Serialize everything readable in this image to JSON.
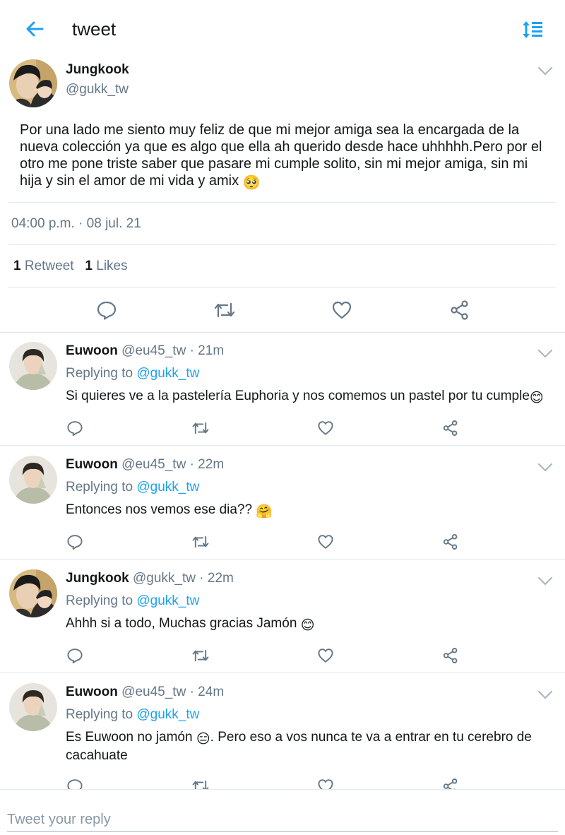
{
  "header": {
    "title": "tweet",
    "back_icon": "arrow-left-icon",
    "sort_icon": "sort-icon",
    "accent": "#1da1f2"
  },
  "tweet": {
    "name": "Jungkook",
    "handle": "@gukk_tw",
    "text": "Por una lado me siento muy feliz de que mi mejor amiga sea la encargada de la nueva colección ya que es algo que ella ah querido desde hace uhhhhh.Pero por el otro me pone triste saber que pasare mi cumple solito, sin mi mejor amiga, sin mi hija y sin el amor de mi vida y amix",
    "emoji": "🥺",
    "timestamp": "04:00 p.m. · 08 jul. 21",
    "retweets_count": "1",
    "retweets_label": "Retweet",
    "likes_count": "1",
    "likes_label": "Likes"
  },
  "replies": [
    {
      "name": "Euwoon",
      "meta": "@eu45_tw · 21m",
      "replying_label": "Replying to",
      "replying_handle": "@gukk_tw",
      "text": "Si quieres ve a la pastelería Euphoria y nos comemos un pastel por tu cumple",
      "emoji": "😊"
    },
    {
      "name": "Euwoon",
      "meta": "@eu45_tw · 22m",
      "replying_label": "Replying to",
      "replying_handle": "@gukk_tw",
      "text": "Entonces nos vemos ese dia?? ",
      "emoji": "🤗"
    },
    {
      "name": "Jungkook",
      "meta": "@gukk_tw · 22m",
      "replying_label": "Replying to",
      "replying_handle": "@gukk_tw",
      "text": "Ahhh si a todo, Muchas gracias Jamón ",
      "emoji": "😊"
    },
    {
      "name": "Euwoon",
      "meta": "@eu45_tw · 24m",
      "replying_label": "Replying to",
      "replying_handle": "@gukk_tw",
      "text_before": "Es Euwoon no jamón ",
      "emoji": "😑",
      "text_after": ". Pero eso a vos nunca te va a entrar en tu cerebro de cacahuate"
    }
  ],
  "reply_box": {
    "placeholder": "Tweet your reply"
  }
}
